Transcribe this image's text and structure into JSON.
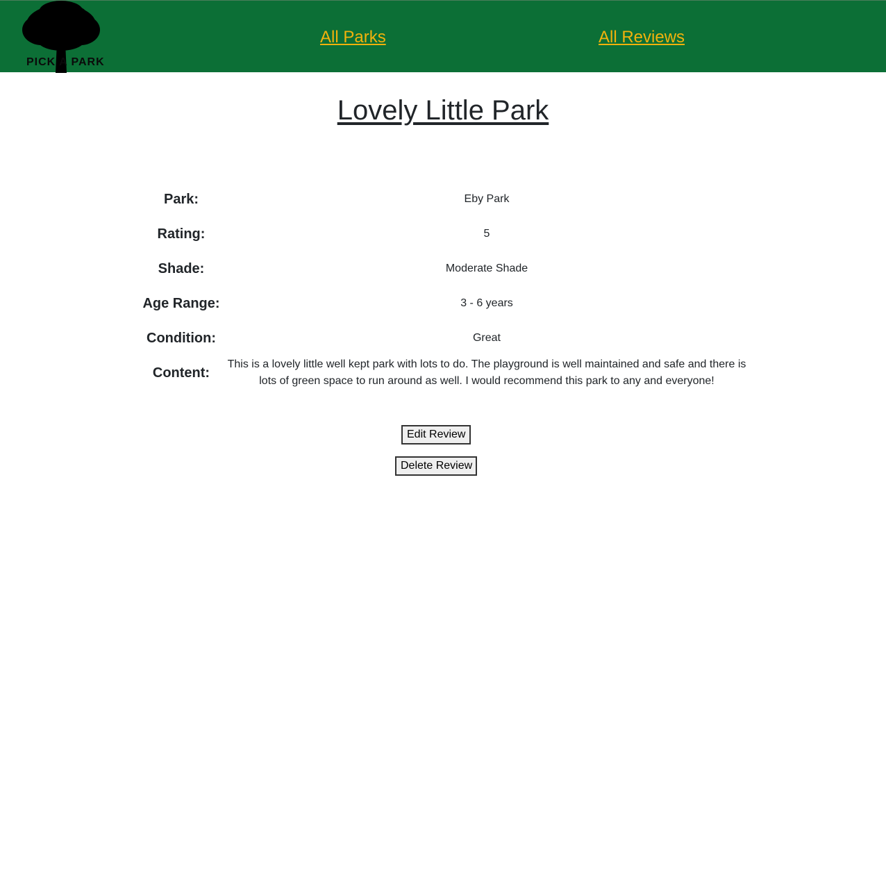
{
  "nav": {
    "logo_text": "PICK A PARK",
    "links": [
      "All Parks",
      "All Reviews"
    ]
  },
  "review": {
    "title": "Lovely Little Park",
    "fields": [
      {
        "label": "Park:",
        "value": "Eby Park"
      },
      {
        "label": "Rating:",
        "value": "5"
      },
      {
        "label": "Shade:",
        "value": "Moderate Shade"
      },
      {
        "label": "Age Range:",
        "value": "3 - 6 years"
      },
      {
        "label": "Condition:",
        "value": "Great"
      },
      {
        "label": "Content:",
        "value": "This is a lovely little well kept park with lots to do. The playground is well maintained and safe and there is lots of green space to run around as well. I would recommend this park to any and everyone!"
      }
    ]
  },
  "actions": {
    "edit_label": "Edit Review",
    "delete_label": "Delete Review"
  },
  "colors": {
    "navbar": "#0c6f36",
    "link": "#f2b20c",
    "text": "#212529"
  }
}
